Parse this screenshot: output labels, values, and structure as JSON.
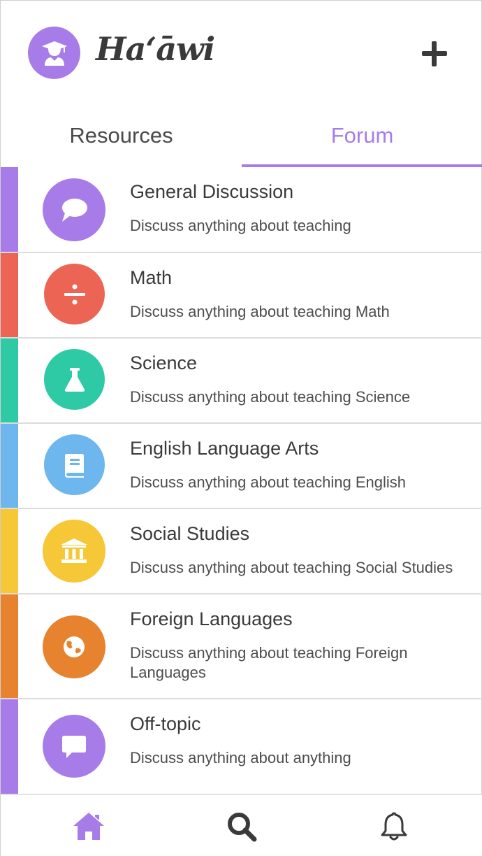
{
  "header": {
    "brand": "Haʻāwi",
    "avatar_icon": "graduate-user-icon",
    "add_icon": "plus-icon"
  },
  "tabs": [
    {
      "label": "Resources",
      "active": false
    },
    {
      "label": "Forum",
      "active": true
    }
  ],
  "colors": {
    "accent": "#a87ce8",
    "purple": "#a87ce8",
    "red": "#ec6453",
    "teal": "#2ecaa5",
    "blue": "#6db7ee",
    "yellow": "#f6c736",
    "orange": "#e7822f",
    "text": "#3a3a3a",
    "nav_icon": "#3a3a3a"
  },
  "forum": [
    {
      "title": "General Discussion",
      "description": "Discuss anything about teaching",
      "color": "#a87ce8",
      "icon": "speech-bubble-icon"
    },
    {
      "title": "Math",
      "description": "Discuss anything about teaching Math",
      "color": "#ec6453",
      "icon": "divide-icon"
    },
    {
      "title": "Science",
      "description": "Discuss anything about teaching Science",
      "color": "#2ecaa5",
      "icon": "flask-icon"
    },
    {
      "title": "English Language Arts",
      "description": "Discuss anything about teaching English",
      "color": "#6db7ee",
      "icon": "book-icon"
    },
    {
      "title": "Social Studies",
      "description": "Discuss anything about teaching Social Studies",
      "color": "#f6c736",
      "icon": "bank-building-icon"
    },
    {
      "title": "Foreign Languages",
      "description": "Discuss anything about teaching Foreign Languages",
      "color": "#e7822f",
      "icon": "globe-icon"
    },
    {
      "title": "Off-topic",
      "description": "Discuss anything about anything",
      "color": "#a87ce8",
      "icon": "chat-square-icon"
    }
  ],
  "bottom_nav": [
    {
      "name": "home",
      "icon": "home-icon",
      "active": true
    },
    {
      "name": "search",
      "icon": "search-icon",
      "active": false
    },
    {
      "name": "notifications",
      "icon": "bell-icon",
      "active": false
    }
  ]
}
